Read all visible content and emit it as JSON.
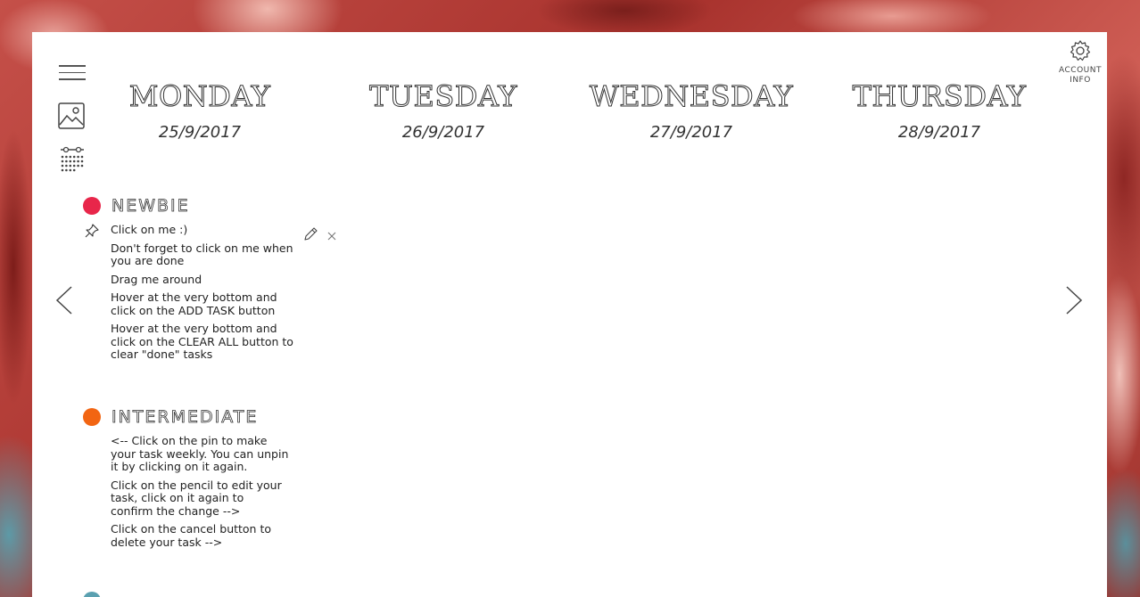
{
  "colors": {
    "newbie": "#e8264a",
    "intermediate": "#f26512",
    "advanced": "#5aa0b0"
  },
  "account": {
    "icon": "gear-icon",
    "label_line1": "ACCOUNT",
    "label_line2": "INFO"
  },
  "sidebar": {
    "menu_icon": "hamburger-icon",
    "image_icon": "image-icon",
    "calendar_icon": "calendar-icon"
  },
  "days": [
    {
      "name": "MONDAY",
      "date": "25/9/2017"
    },
    {
      "name": "TUESDAY",
      "date": "26/9/2017"
    },
    {
      "name": "WEDNESDAY",
      "date": "27/9/2017"
    },
    {
      "name": "THURSDAY",
      "date": "28/9/2017"
    }
  ],
  "groups": [
    {
      "title": "NEWBIE",
      "tasks": [
        "Click on me :)",
        "Don't forget to click on me when you are done",
        "Drag me around",
        "Hover at the very bottom and click on the ADD TASK button",
        "Hover at the very bottom and click on the CLEAR ALL button to clear \"done\" tasks"
      ]
    },
    {
      "title": "INTERMEDIATE",
      "tasks": [
        "<-- Click on the pin to make your task weekly. You can unpin it by clicking on it again.",
        "Click on the pencil to edit your task, click on it again to confirm the change -->",
        "Click on the cancel button to delete your task -->"
      ]
    }
  ],
  "task_actions": {
    "pin_icon": "pin-icon",
    "edit_icon": "pencil-icon",
    "delete_icon": "close-icon"
  },
  "navigation": {
    "prev_icon": "chevron-left-icon",
    "next_icon": "chevron-right-icon"
  }
}
